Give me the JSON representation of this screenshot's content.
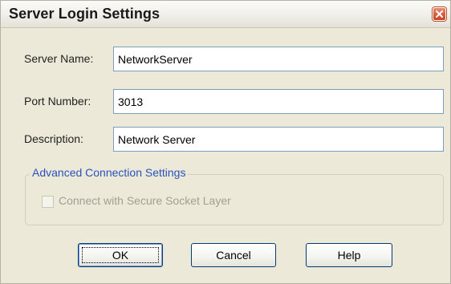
{
  "window": {
    "title": "Server Login Settings",
    "close_icon": "close-icon"
  },
  "fields": {
    "server_name": {
      "label": "Server Name:",
      "value": "NetworkServer"
    },
    "port_number": {
      "label": "Port Number:",
      "value": "3013"
    },
    "description": {
      "label": "Description:",
      "value": "Network Server"
    }
  },
  "advanced": {
    "legend": "Advanced Connection Settings",
    "ssl_checkbox": {
      "label": "Connect with Secure Socket Layer",
      "checked": false,
      "enabled": false
    }
  },
  "buttons": {
    "ok": "OK",
    "cancel": "Cancel",
    "help": "Help"
  },
  "colors": {
    "dialog_bg": "#ece9d8",
    "legend_blue": "#2a52be",
    "close_red": "#d95a3b",
    "disabled_text": "#a19f94"
  }
}
